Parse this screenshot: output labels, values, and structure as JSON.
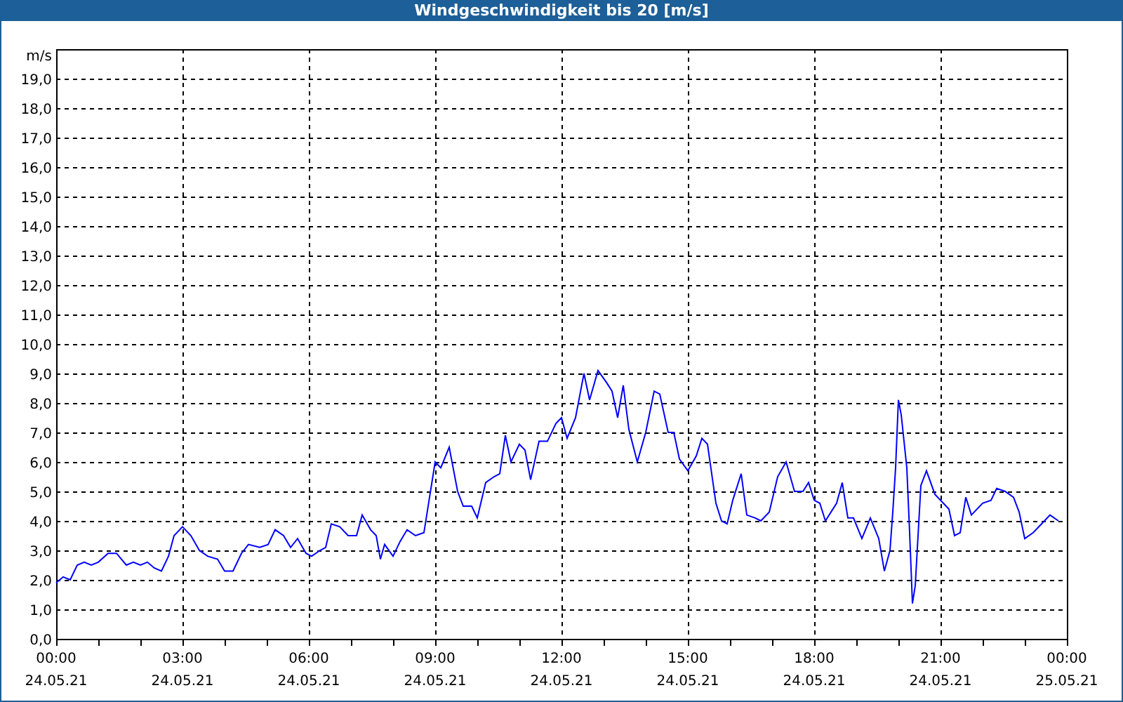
{
  "window": {
    "title": "Windgeschwindigkeit bis 20 [m/s]"
  },
  "chart_data": {
    "type": "line",
    "ylabel": "m/s",
    "grid": true,
    "xlim": [
      "--05-24 00:00",
      "--05-25 00:00"
    ],
    "ylim": [
      0,
      20
    ],
    "yticks": [
      {
        "value": 0,
        "label": "0,0"
      },
      {
        "value": 1,
        "label": "1,0"
      },
      {
        "value": 2,
        "label": "2,0"
      },
      {
        "value": 3,
        "label": "3,0"
      },
      {
        "value": 4,
        "label": "4,0"
      },
      {
        "value": 5,
        "label": "5,0"
      },
      {
        "value": 6,
        "label": "6,0"
      },
      {
        "value": 7,
        "label": "7,0"
      },
      {
        "value": 8,
        "label": "8,0"
      },
      {
        "value": 9,
        "label": "9,0"
      },
      {
        "value": 10,
        "label": "10,0"
      },
      {
        "value": 11,
        "label": "11,0"
      },
      {
        "value": 12,
        "label": "12,0"
      },
      {
        "value": 13,
        "label": "13,0"
      },
      {
        "value": 14,
        "label": "14,0"
      },
      {
        "value": 15,
        "label": "15,0"
      },
      {
        "value": 16,
        "label": "16,0"
      },
      {
        "value": 17,
        "label": "17,0"
      },
      {
        "value": 18,
        "label": "18,0"
      },
      {
        "value": 19,
        "label": "19,0"
      }
    ],
    "xticks": [
      {
        "value": "--05-24 00:00",
        "label": "00:00\n24.05.21"
      },
      {
        "value": "--05-24 03:00",
        "label": "03:00\n24.05.21"
      },
      {
        "value": "--05-24 06:00",
        "label": "06:00\n24.05.21"
      },
      {
        "value": "--05-24 09:00",
        "label": "09:00\n24.05.21"
      },
      {
        "value": "--05-24 12:00",
        "label": "12:00\n24.05.21"
      },
      {
        "value": "--05-24 15:00",
        "label": "15:00\n24.05.21"
      },
      {
        "value": "--05-24 18:00",
        "label": "18:00\n24.05.21"
      },
      {
        "value": "--05-24 21:00",
        "label": "21:00\n24.05.21"
      },
      {
        "value": "--05-25 00:00",
        "label": "00:00\n25.05.21"
      }
    ],
    "x": [
      "--05-24 00:00",
      "--05-24 00:10",
      "--05-24 00:20",
      "--05-24 00:30",
      "--05-24 00:40",
      "--05-24 00:50",
      "--05-24 01:00",
      "--05-24 01:14",
      "--05-24 01:26",
      "--05-24 01:40",
      "--05-24 01:50",
      "--05-24 02:00",
      "--05-24 02:10",
      "--05-24 02:20",
      "--05-24 02:30",
      "--05-24 02:40",
      "--05-24 02:48",
      "--05-24 03:00",
      "--05-24 03:12",
      "--05-24 03:24",
      "--05-24 03:36",
      "--05-24 03:50",
      "--05-24 04:00",
      "--05-24 04:12",
      "--05-24 04:24",
      "--05-24 04:34",
      "--05-24 04:50",
      "--05-24 05:02",
      "--05-24 05:12",
      "--05-24 05:24",
      "--05-24 05:34",
      "--05-24 05:44",
      "--05-24 05:56",
      "--05-24 06:04",
      "--05-24 06:16",
      "--05-24 06:24",
      "--05-24 06:32",
      "--05-24 06:44",
      "--05-24 06:56",
      "--05-24 07:08",
      "--05-24 07:16",
      "--05-24 07:28",
      "--05-24 07:36",
      "--05-24 07:42",
      "--05-24 07:48",
      "--05-24 08:00",
      "--05-24 08:10",
      "--05-24 08:20",
      "--05-24 08:32",
      "--05-24 08:44",
      "--05-24 08:52",
      "--05-24 09:00",
      "--05-24 09:08",
      "--05-24 09:20",
      "--05-24 09:32",
      "--05-24 09:40",
      "--05-24 09:52",
      "--05-24 10:00",
      "--05-24 10:12",
      "--05-24 10:24",
      "--05-24 10:32",
      "--05-24 10:40",
      "--05-24 10:48",
      "--05-24 11:00",
      "--05-24 11:08",
      "--05-24 11:16",
      "--05-24 11:28",
      "--05-24 11:40",
      "--05-24 11:52",
      "--05-24 12:00",
      "--05-24 12:08",
      "--05-24 12:20",
      "--05-24 12:32",
      "--05-24 12:40",
      "--05-24 12:52",
      "--05-24 13:04",
      "--05-24 13:12",
      "--05-24 13:20",
      "--05-24 13:28",
      "--05-24 13:36",
      "--05-24 13:48",
      "--05-24 14:00",
      "--05-24 14:12",
      "--05-24 14:20",
      "--05-24 14:32",
      "--05-24 14:40",
      "--05-24 14:48",
      "--05-24 15:00",
      "--05-24 15:12",
      "--05-24 15:20",
      "--05-24 15:28",
      "--05-24 15:40",
      "--05-24 15:48",
      "--05-24 15:56",
      "--05-24 16:04",
      "--05-24 16:16",
      "--05-24 16:24",
      "--05-24 16:36",
      "--05-24 16:44",
      "--05-24 16:56",
      "--05-24 17:08",
      "--05-24 17:20",
      "--05-24 17:32",
      "--05-24 17:44",
      "--05-24 17:52",
      "--05-24 18:00",
      "--05-24 18:08",
      "--05-24 18:16",
      "--05-24 18:24",
      "--05-24 18:32",
      "--05-24 18:40",
      "--05-24 18:48",
      "--05-24 18:56",
      "--05-24 19:08",
      "--05-24 19:20",
      "--05-24 19:32",
      "--05-24 19:40",
      "--05-24 19:48",
      "--05-24 19:52",
      "--05-24 19:56",
      "--05-24 20:00",
      "--05-24 20:04",
      "--05-24 20:12",
      "--05-24 20:16",
      "--05-24 20:20",
      "--05-24 20:24",
      "--05-24 20:32",
      "--05-24 20:40",
      "--05-24 20:52",
      "--05-24 21:04",
      "--05-24 21:12",
      "--05-24 21:20",
      "--05-24 21:28",
      "--05-24 21:36",
      "--05-24 21:44",
      "--05-24 22:00",
      "--05-24 22:12",
      "--05-24 22:20",
      "--05-24 22:32",
      "--05-24 22:44",
      "--05-24 22:52",
      "--05-24 23:00",
      "--05-24 23:12",
      "--05-24 23:24",
      "--05-24 23:36",
      "--05-24 23:48"
    ],
    "series": [
      {
        "color": "#0000ff",
        "values": [
          1.9,
          2.1,
          2.0,
          2.5,
          2.6,
          2.5,
          2.6,
          2.9,
          2.9,
          2.5,
          2.6,
          2.5,
          2.6,
          2.4,
          2.3,
          2.8,
          3.5,
          3.8,
          3.5,
          3.0,
          2.8,
          2.7,
          2.3,
          2.3,
          2.9,
          3.2,
          3.1,
          3.2,
          3.7,
          3.5,
          3.1,
          3.4,
          2.9,
          2.8,
          3.0,
          3.1,
          3.9,
          3.8,
          3.5,
          3.5,
          4.2,
          3.7,
          3.5,
          2.7,
          3.2,
          2.8,
          3.3,
          3.7,
          3.5,
          3.6,
          4.8,
          6.0,
          5.8,
          6.5,
          5.0,
          4.5,
          4.5,
          4.1,
          5.3,
          5.5,
          5.6,
          6.9,
          6.0,
          6.6,
          6.4,
          5.4,
          6.7,
          6.7,
          7.3,
          7.5,
          6.8,
          7.5,
          9.0,
          8.1,
          9.1,
          8.7,
          8.4,
          7.5,
          8.6,
          7.1,
          6.0,
          7.0,
          8.4,
          8.3,
          7.0,
          7.0,
          6.1,
          5.7,
          6.2,
          6.8,
          6.6,
          4.6,
          4.0,
          3.9,
          4.7,
          5.6,
          4.2,
          4.1,
          4.0,
          4.3,
          5.5,
          6.0,
          5.0,
          5.0,
          5.3,
          4.7,
          4.6,
          4.0,
          4.3,
          4.6,
          5.3,
          4.1,
          4.1,
          3.4,
          4.1,
          3.4,
          2.3,
          3.0,
          4.3,
          5.8,
          8.1,
          7.6,
          5.8,
          3.6,
          1.2,
          1.8,
          5.2,
          5.7,
          4.9,
          4.6,
          4.4,
          3.5,
          3.6,
          4.8,
          4.2,
          4.6,
          4.7,
          5.1,
          5.0,
          4.8,
          4.3,
          3.4,
          3.6,
          3.9,
          4.2,
          4.0
        ]
      }
    ]
  }
}
